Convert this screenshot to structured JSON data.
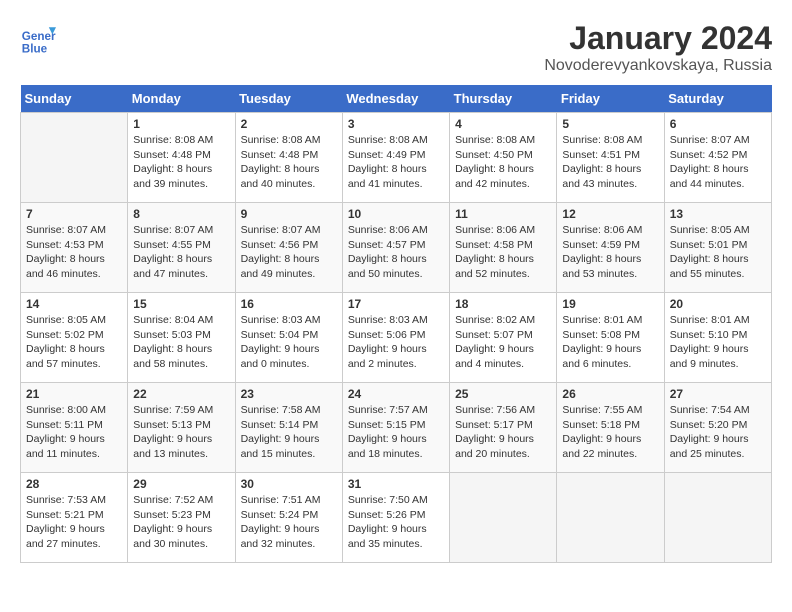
{
  "header": {
    "logo_line1": "General",
    "logo_line2": "Blue",
    "title": "January 2024",
    "subtitle": "Novoderevyankovskaya, Russia"
  },
  "calendar": {
    "days_of_week": [
      "Sunday",
      "Monday",
      "Tuesday",
      "Wednesday",
      "Thursday",
      "Friday",
      "Saturday"
    ],
    "weeks": [
      [
        {
          "day": "",
          "sunrise": "",
          "sunset": "",
          "daylight": ""
        },
        {
          "day": "1",
          "sunrise": "Sunrise: 8:08 AM",
          "sunset": "Sunset: 4:48 PM",
          "daylight": "Daylight: 8 hours and 39 minutes."
        },
        {
          "day": "2",
          "sunrise": "Sunrise: 8:08 AM",
          "sunset": "Sunset: 4:48 PM",
          "daylight": "Daylight: 8 hours and 40 minutes."
        },
        {
          "day": "3",
          "sunrise": "Sunrise: 8:08 AM",
          "sunset": "Sunset: 4:49 PM",
          "daylight": "Daylight: 8 hours and 41 minutes."
        },
        {
          "day": "4",
          "sunrise": "Sunrise: 8:08 AM",
          "sunset": "Sunset: 4:50 PM",
          "daylight": "Daylight: 8 hours and 42 minutes."
        },
        {
          "day": "5",
          "sunrise": "Sunrise: 8:08 AM",
          "sunset": "Sunset: 4:51 PM",
          "daylight": "Daylight: 8 hours and 43 minutes."
        },
        {
          "day": "6",
          "sunrise": "Sunrise: 8:07 AM",
          "sunset": "Sunset: 4:52 PM",
          "daylight": "Daylight: 8 hours and 44 minutes."
        }
      ],
      [
        {
          "day": "7",
          "sunrise": "Sunrise: 8:07 AM",
          "sunset": "Sunset: 4:53 PM",
          "daylight": "Daylight: 8 hours and 46 minutes."
        },
        {
          "day": "8",
          "sunrise": "Sunrise: 8:07 AM",
          "sunset": "Sunset: 4:55 PM",
          "daylight": "Daylight: 8 hours and 47 minutes."
        },
        {
          "day": "9",
          "sunrise": "Sunrise: 8:07 AM",
          "sunset": "Sunset: 4:56 PM",
          "daylight": "Daylight: 8 hours and 49 minutes."
        },
        {
          "day": "10",
          "sunrise": "Sunrise: 8:06 AM",
          "sunset": "Sunset: 4:57 PM",
          "daylight": "Daylight: 8 hours and 50 minutes."
        },
        {
          "day": "11",
          "sunrise": "Sunrise: 8:06 AM",
          "sunset": "Sunset: 4:58 PM",
          "daylight": "Daylight: 8 hours and 52 minutes."
        },
        {
          "day": "12",
          "sunrise": "Sunrise: 8:06 AM",
          "sunset": "Sunset: 4:59 PM",
          "daylight": "Daylight: 8 hours and 53 minutes."
        },
        {
          "day": "13",
          "sunrise": "Sunrise: 8:05 AM",
          "sunset": "Sunset: 5:01 PM",
          "daylight": "Daylight: 8 hours and 55 minutes."
        }
      ],
      [
        {
          "day": "14",
          "sunrise": "Sunrise: 8:05 AM",
          "sunset": "Sunset: 5:02 PM",
          "daylight": "Daylight: 8 hours and 57 minutes."
        },
        {
          "day": "15",
          "sunrise": "Sunrise: 8:04 AM",
          "sunset": "Sunset: 5:03 PM",
          "daylight": "Daylight: 8 hours and 58 minutes."
        },
        {
          "day": "16",
          "sunrise": "Sunrise: 8:03 AM",
          "sunset": "Sunset: 5:04 PM",
          "daylight": "Daylight: 9 hours and 0 minutes."
        },
        {
          "day": "17",
          "sunrise": "Sunrise: 8:03 AM",
          "sunset": "Sunset: 5:06 PM",
          "daylight": "Daylight: 9 hours and 2 minutes."
        },
        {
          "day": "18",
          "sunrise": "Sunrise: 8:02 AM",
          "sunset": "Sunset: 5:07 PM",
          "daylight": "Daylight: 9 hours and 4 minutes."
        },
        {
          "day": "19",
          "sunrise": "Sunrise: 8:01 AM",
          "sunset": "Sunset: 5:08 PM",
          "daylight": "Daylight: 9 hours and 6 minutes."
        },
        {
          "day": "20",
          "sunrise": "Sunrise: 8:01 AM",
          "sunset": "Sunset: 5:10 PM",
          "daylight": "Daylight: 9 hours and 9 minutes."
        }
      ],
      [
        {
          "day": "21",
          "sunrise": "Sunrise: 8:00 AM",
          "sunset": "Sunset: 5:11 PM",
          "daylight": "Daylight: 9 hours and 11 minutes."
        },
        {
          "day": "22",
          "sunrise": "Sunrise: 7:59 AM",
          "sunset": "Sunset: 5:13 PM",
          "daylight": "Daylight: 9 hours and 13 minutes."
        },
        {
          "day": "23",
          "sunrise": "Sunrise: 7:58 AM",
          "sunset": "Sunset: 5:14 PM",
          "daylight": "Daylight: 9 hours and 15 minutes."
        },
        {
          "day": "24",
          "sunrise": "Sunrise: 7:57 AM",
          "sunset": "Sunset: 5:15 PM",
          "daylight": "Daylight: 9 hours and 18 minutes."
        },
        {
          "day": "25",
          "sunrise": "Sunrise: 7:56 AM",
          "sunset": "Sunset: 5:17 PM",
          "daylight": "Daylight: 9 hours and 20 minutes."
        },
        {
          "day": "26",
          "sunrise": "Sunrise: 7:55 AM",
          "sunset": "Sunset: 5:18 PM",
          "daylight": "Daylight: 9 hours and 22 minutes."
        },
        {
          "day": "27",
          "sunrise": "Sunrise: 7:54 AM",
          "sunset": "Sunset: 5:20 PM",
          "daylight": "Daylight: 9 hours and 25 minutes."
        }
      ],
      [
        {
          "day": "28",
          "sunrise": "Sunrise: 7:53 AM",
          "sunset": "Sunset: 5:21 PM",
          "daylight": "Daylight: 9 hours and 27 minutes."
        },
        {
          "day": "29",
          "sunrise": "Sunrise: 7:52 AM",
          "sunset": "Sunset: 5:23 PM",
          "daylight": "Daylight: 9 hours and 30 minutes."
        },
        {
          "day": "30",
          "sunrise": "Sunrise: 7:51 AM",
          "sunset": "Sunset: 5:24 PM",
          "daylight": "Daylight: 9 hours and 32 minutes."
        },
        {
          "day": "31",
          "sunrise": "Sunrise: 7:50 AM",
          "sunset": "Sunset: 5:26 PM",
          "daylight": "Daylight: 9 hours and 35 minutes."
        },
        {
          "day": "",
          "sunrise": "",
          "sunset": "",
          "daylight": ""
        },
        {
          "day": "",
          "sunrise": "",
          "sunset": "",
          "daylight": ""
        },
        {
          "day": "",
          "sunrise": "",
          "sunset": "",
          "daylight": ""
        }
      ]
    ]
  }
}
